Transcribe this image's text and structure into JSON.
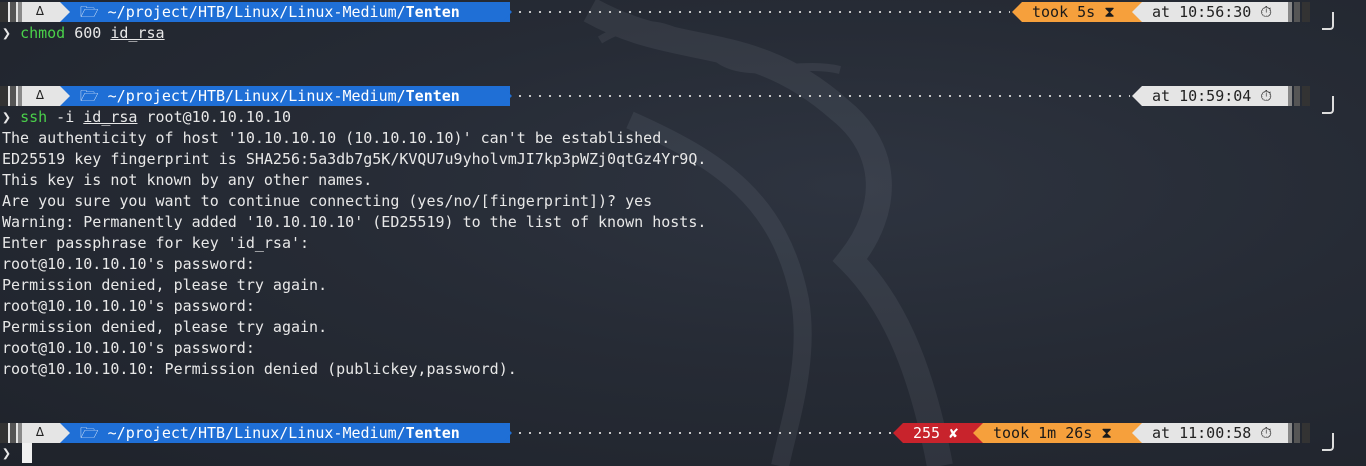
{
  "prompt": {
    "os_logo": "∆",
    "folder_icon": "🗁",
    "path_prefix": "~/project/HTB/Linux/Linux-Medium/",
    "path_bold": "Tenten"
  },
  "block1": {
    "took": "took 5s ⧗",
    "at": "at 10:56:30 ⏱",
    "symbol": "❯",
    "cmd": "chmod",
    "args_pre": " 600 ",
    "arg_u": "id_rsa"
  },
  "block2": {
    "at": "at 10:59:04 ⏱",
    "symbol": "❯",
    "cmd": "ssh",
    "args_pre": " -i ",
    "arg_u": "id_rsa",
    "args_post": " root@10.10.10.10",
    "output": [
      "The authenticity of host '10.10.10.10 (10.10.10.10)' can't be established.",
      "ED25519 key fingerprint is SHA256:5a3db7g5K/KVQU7u9yholvmJI7kp3pWZj0qtGz4Yr9Q.",
      "This key is not known by any other names.",
      "Are you sure you want to continue connecting (yes/no/[fingerprint])? yes",
      "Warning: Permanently added '10.10.10.10' (ED25519) to the list of known hosts.",
      "Enter passphrase for key 'id_rsa':",
      "root@10.10.10.10's password:",
      "Permission denied, please try again.",
      "root@10.10.10.10's password:",
      "Permission denied, please try again.",
      "root@10.10.10.10's password:",
      "root@10.10.10.10: Permission denied (publickey,password)."
    ]
  },
  "block3": {
    "err": "255 ✘",
    "took": "took 1m 26s ⧗",
    "at": "at 11:00:58 ⏱",
    "symbol": "❯"
  },
  "colors": {
    "dir_bg": "#1f6fd6",
    "took_bg": "#f6a03c",
    "err_bg": "#c8232c",
    "cmd_green": "#4ad04a"
  }
}
